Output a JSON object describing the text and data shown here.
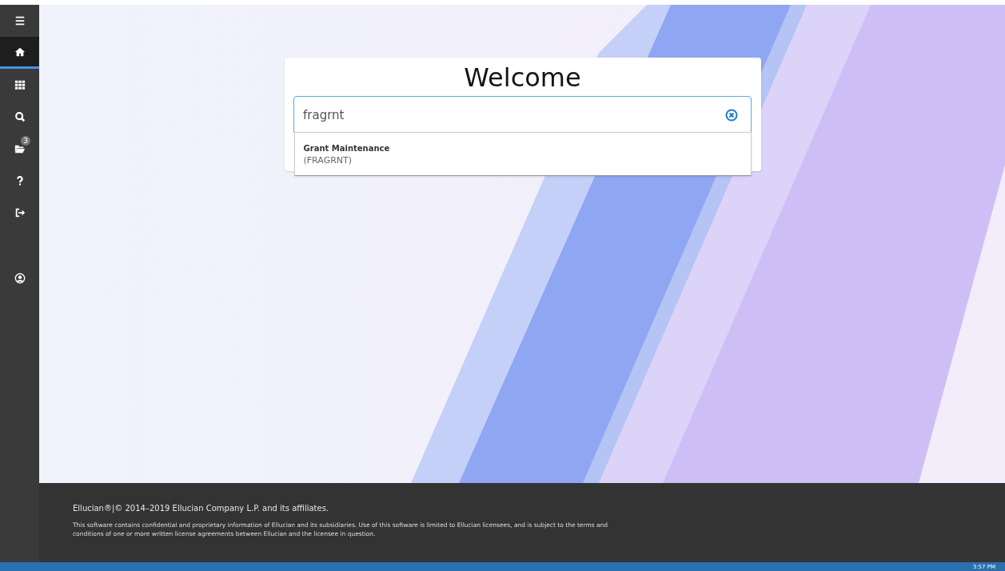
{
  "sidebar": {
    "items": [
      {
        "kind": "menu",
        "selected": false
      },
      {
        "kind": "home",
        "selected": true
      },
      {
        "kind": "grid",
        "selected": false
      },
      {
        "kind": "search",
        "selected": false
      },
      {
        "kind": "folder",
        "selected": false,
        "badge": "3"
      },
      {
        "kind": "help",
        "selected": false
      },
      {
        "kind": "signout",
        "selected": false
      },
      {
        "kind": "user",
        "selected": false
      }
    ]
  },
  "welcome": {
    "title": "Welcome",
    "search": {
      "value": "fragrnt"
    },
    "results": [
      {
        "name": "Grant Maintenance",
        "code": "(FRAGRNT)"
      }
    ]
  },
  "footer": {
    "copyright": "Ellucian®|© 2014–2019 Ellucian Company L.P. and its affiliates.",
    "notice": "This software contains confidential and proprietary information of Ellucian and its subsidiaries. Use of this software is limited to Ellucian licensees, and is subject to the terms and conditions of one or more written license agreements between Ellucian and the licensee in question."
  },
  "taskbar": {
    "time": "3:57 PM"
  }
}
